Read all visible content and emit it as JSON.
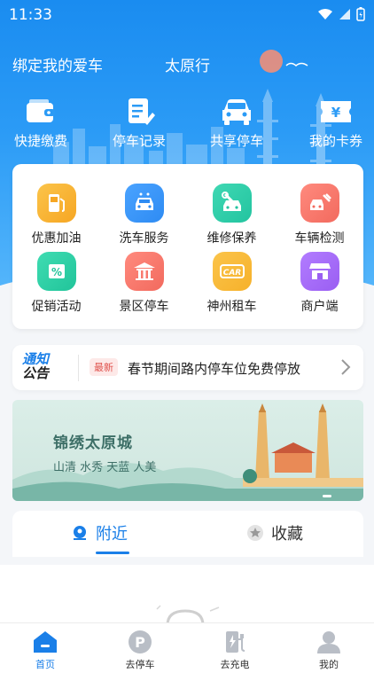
{
  "status_bar": {
    "time": "11:33"
  },
  "header": {
    "bind_car": "绑定我的爱车",
    "city": "太原行"
  },
  "quick_actions": [
    {
      "label": "快捷缴费",
      "icon": "wallet-icon"
    },
    {
      "label": "停车记录",
      "icon": "document-edit-icon"
    },
    {
      "label": "共享停车",
      "icon": "car-front-icon"
    },
    {
      "label": "我的卡券",
      "icon": "ticket-yuan-icon"
    }
  ],
  "services": [
    {
      "label": "优惠加油",
      "icon": "fuel-icon",
      "color": "#f6a623"
    },
    {
      "label": "洗车服务",
      "icon": "car-wash-icon",
      "color": "#2e8bf3"
    },
    {
      "label": "维修保养",
      "icon": "wrench-car-icon",
      "color": "#23c4a0"
    },
    {
      "label": "车辆检测",
      "icon": "inspection-icon",
      "color": "#f26a5e"
    },
    {
      "label": "促销活动",
      "icon": "percent-icon",
      "color": "#21c49a"
    },
    {
      "label": "景区停车",
      "icon": "temple-icon",
      "color": "#f26a5e"
    },
    {
      "label": "神州租车",
      "icon": "car-rental-icon",
      "color": "#f6b12b"
    },
    {
      "label": "商户端",
      "icon": "store-icon",
      "color": "#9a5ef2"
    }
  ],
  "notice": {
    "logo_line1": "通知",
    "logo_line2": "公告",
    "badge": "最新",
    "text": "春节期间路内停车位免费停放"
  },
  "banner": {
    "title": "锦绣太原城",
    "subtitle": "山清  水秀  天蓝  人美"
  },
  "tabs": [
    {
      "label": "附近",
      "active": true
    },
    {
      "label": "收藏",
      "active": false
    }
  ],
  "bottom_nav": [
    {
      "label": "首页",
      "icon": "home-icon",
      "active": true
    },
    {
      "label": "去停车",
      "icon": "parking-icon",
      "active": false
    },
    {
      "label": "去充电",
      "icon": "charging-icon",
      "active": false
    },
    {
      "label": "我的",
      "icon": "user-icon",
      "active": false
    }
  ],
  "colors": {
    "primary": "#1a7fe8",
    "hero": "#1a8cf0",
    "notice_badge": "#e0524d"
  }
}
